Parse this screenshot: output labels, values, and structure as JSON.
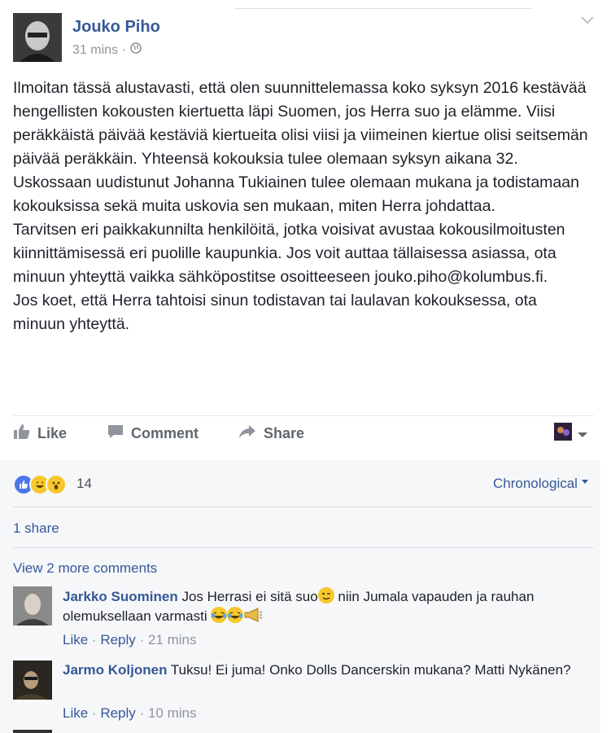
{
  "post": {
    "author": "Jouko Piho",
    "time": "31 mins",
    "paragraphs": [
      "Ilmoitan tässä alustavasti, että olen suunnittelemassa koko syksyn 2016 kestävää hengellisten kokousten kiertuetta läpi Suomen, jos Herra suo ja elämme. Viisi peräkkäistä päivää kestäviä kiertueita olisi viisi ja viimeinen kiertue olisi seitsemän päivää peräkkäin. Yhteensä kokouksia tulee olemaan syksyn aikana 32.",
      "Uskossaan uudistunut Johanna Tukiainen tulee olemaan mukana ja todistamaan kokouksissa sekä muita uskovia sen mukaan, miten Herra johdattaa.",
      "Tarvitsen eri paikkakunnilta henkilöitä, jotka voisivat avustaa kokousilmoitusten kiinnittämisessä eri puolille kaupunkia. Jos voit auttaa tällaisessa asiassa, ota minuun yhteyttä vaikka sähköpostitse osoitteeseen jouko.piho@kolumbus.fi.",
      "Jos koet, että Herra tahtoisi sinun todistavan tai laulavan kokouksessa, ota minuun yhteyttä."
    ]
  },
  "actions": {
    "like": "Like",
    "comment": "Comment",
    "share": "Share"
  },
  "feedback": {
    "reaction_count": "14",
    "order": "Chronological",
    "shares": "1 share",
    "more_comments": "View 2 more comments"
  },
  "comments": [
    {
      "name": "Jarkko Suominen",
      "text_a": "Jos Herrasi ei sitä suo",
      "text_b": " niin Jumala vapauden ja rauhan olemuksellaan varmasti ",
      "like": "Like",
      "reply": "Reply",
      "time": "21 mins"
    },
    {
      "name": "Jarmo Koljonen",
      "text": "Tuksu! Ei juma! Onko Dolls Dancerskin mukana? Matti Nykänen?",
      "like": "Like",
      "reply": "Reply",
      "time": "10 mins"
    }
  ],
  "icons": {
    "privacy": "globe-icon",
    "menu": "chevron-down-icon",
    "like": "thumbs-up-icon",
    "comment": "speech-bubble-icon",
    "share": "share-arrow-icon",
    "reactions": [
      "like-reaction-icon",
      "haha-reaction-icon",
      "wow-reaction-icon"
    ]
  },
  "colors": {
    "link": "#365899",
    "text": "#1d2129",
    "muted": "#90949c",
    "like_blue": "#4a76e8"
  }
}
